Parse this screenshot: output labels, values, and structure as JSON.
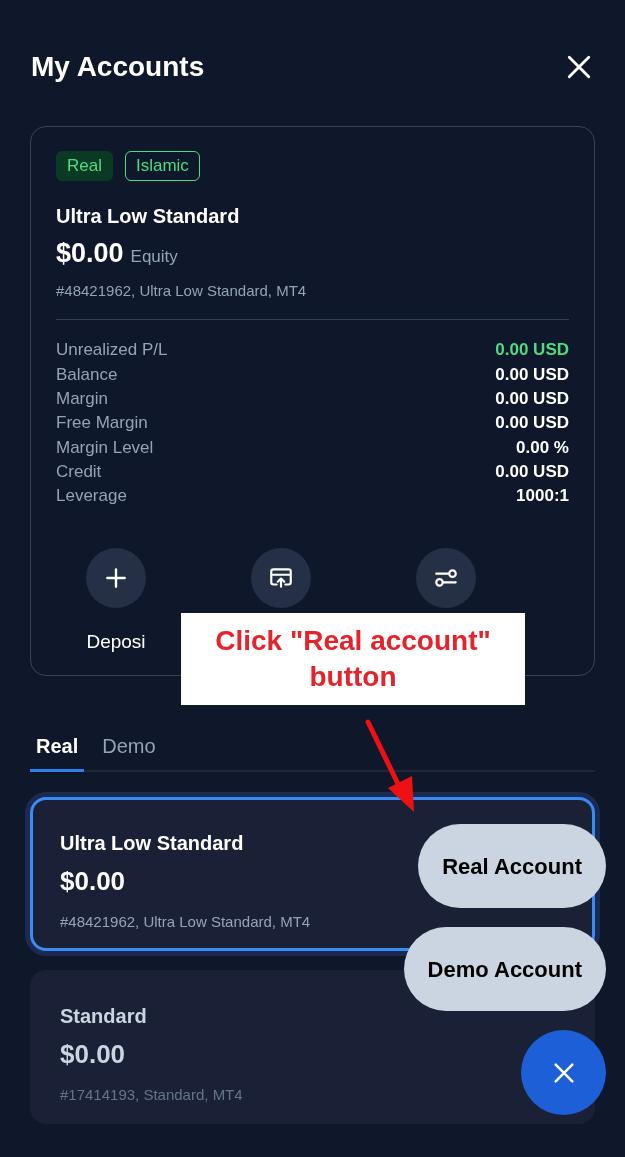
{
  "header": {
    "title": "My Accounts"
  },
  "summary": {
    "badges": [
      {
        "label": "Real",
        "kind": "filled"
      },
      {
        "label": "Islamic",
        "kind": "outline"
      }
    ],
    "name": "Ultra Low Standard",
    "amount": "$0.00",
    "amount_label": "Equity",
    "details": "#48421962, Ultra Low Standard, MT4",
    "stats": [
      {
        "label": "Unrealized P/L",
        "value": "0.00 USD",
        "color": "#4ade80"
      },
      {
        "label": "Balance",
        "value": "0.00 USD",
        "color": "#ffffff"
      },
      {
        "label": "Margin",
        "value": "0.00 USD",
        "color": "#ffffff"
      },
      {
        "label": "Free Margin",
        "value": "0.00 USD",
        "color": "#ffffff"
      },
      {
        "label": "Margin Level",
        "value": "0.00 %",
        "color": "#ffffff"
      },
      {
        "label": "Credit",
        "value": "0.00 USD",
        "color": "#ffffff"
      },
      {
        "label": "Leverage",
        "value": "1000:1",
        "color": "#ffffff"
      }
    ],
    "actions": [
      {
        "kind": "plus",
        "label": "Deposi"
      },
      {
        "kind": "transfer"
      },
      {
        "kind": "sliders"
      }
    ]
  },
  "tabs": [
    {
      "label": "Real",
      "selected": true
    },
    {
      "label": "Demo",
      "selected": false
    }
  ],
  "accounts": [
    {
      "name": "Ultra Low Standard",
      "amount": "$0.00",
      "details": "#48421962, Ultra Low Standard, MT4",
      "selected": true
    },
    {
      "name": "Standard",
      "amount": "$0.00",
      "details": "#17414193, Standard, MT4",
      "selected": false
    }
  ],
  "fab_menu": [
    "Real Account",
    "Demo Account"
  ],
  "annotation": {
    "text": "Click \"Real account\" button"
  }
}
